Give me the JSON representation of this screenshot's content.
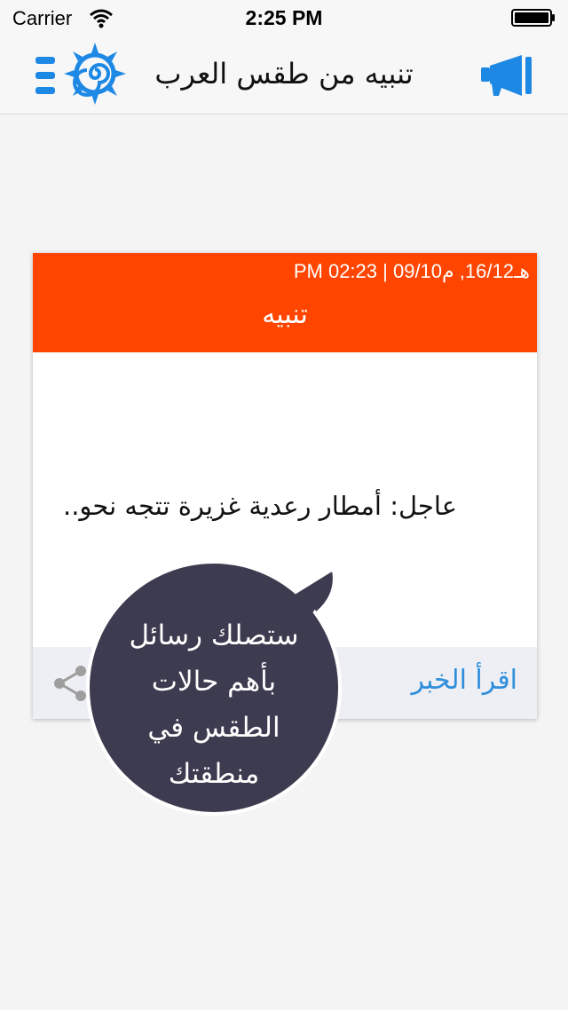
{
  "status_bar": {
    "carrier": "Carrier",
    "time": "2:25 PM"
  },
  "nav": {
    "title": "تنبيه من طقس العرب",
    "icons": {
      "menu": "menu-icon",
      "logo": "sun-spiral-logo",
      "alerts": "megaphone-icon"
    },
    "accent_color": "#1e88e5"
  },
  "alert_card": {
    "date": "هـ16/12, م09/10 | 02:23 PM",
    "title": "تنبيه",
    "message": "عاجل: أمطار رعدية غزيرة تتجه نحو..",
    "read_more": "اقرأ الخبر",
    "header_color": "#ff4500"
  },
  "tooltip": {
    "lines": [
      "ستصلك رسائل",
      "بأهم حالات",
      "الطقس في",
      "منطقتك"
    ],
    "bubble_color": "#3d3b4f"
  }
}
